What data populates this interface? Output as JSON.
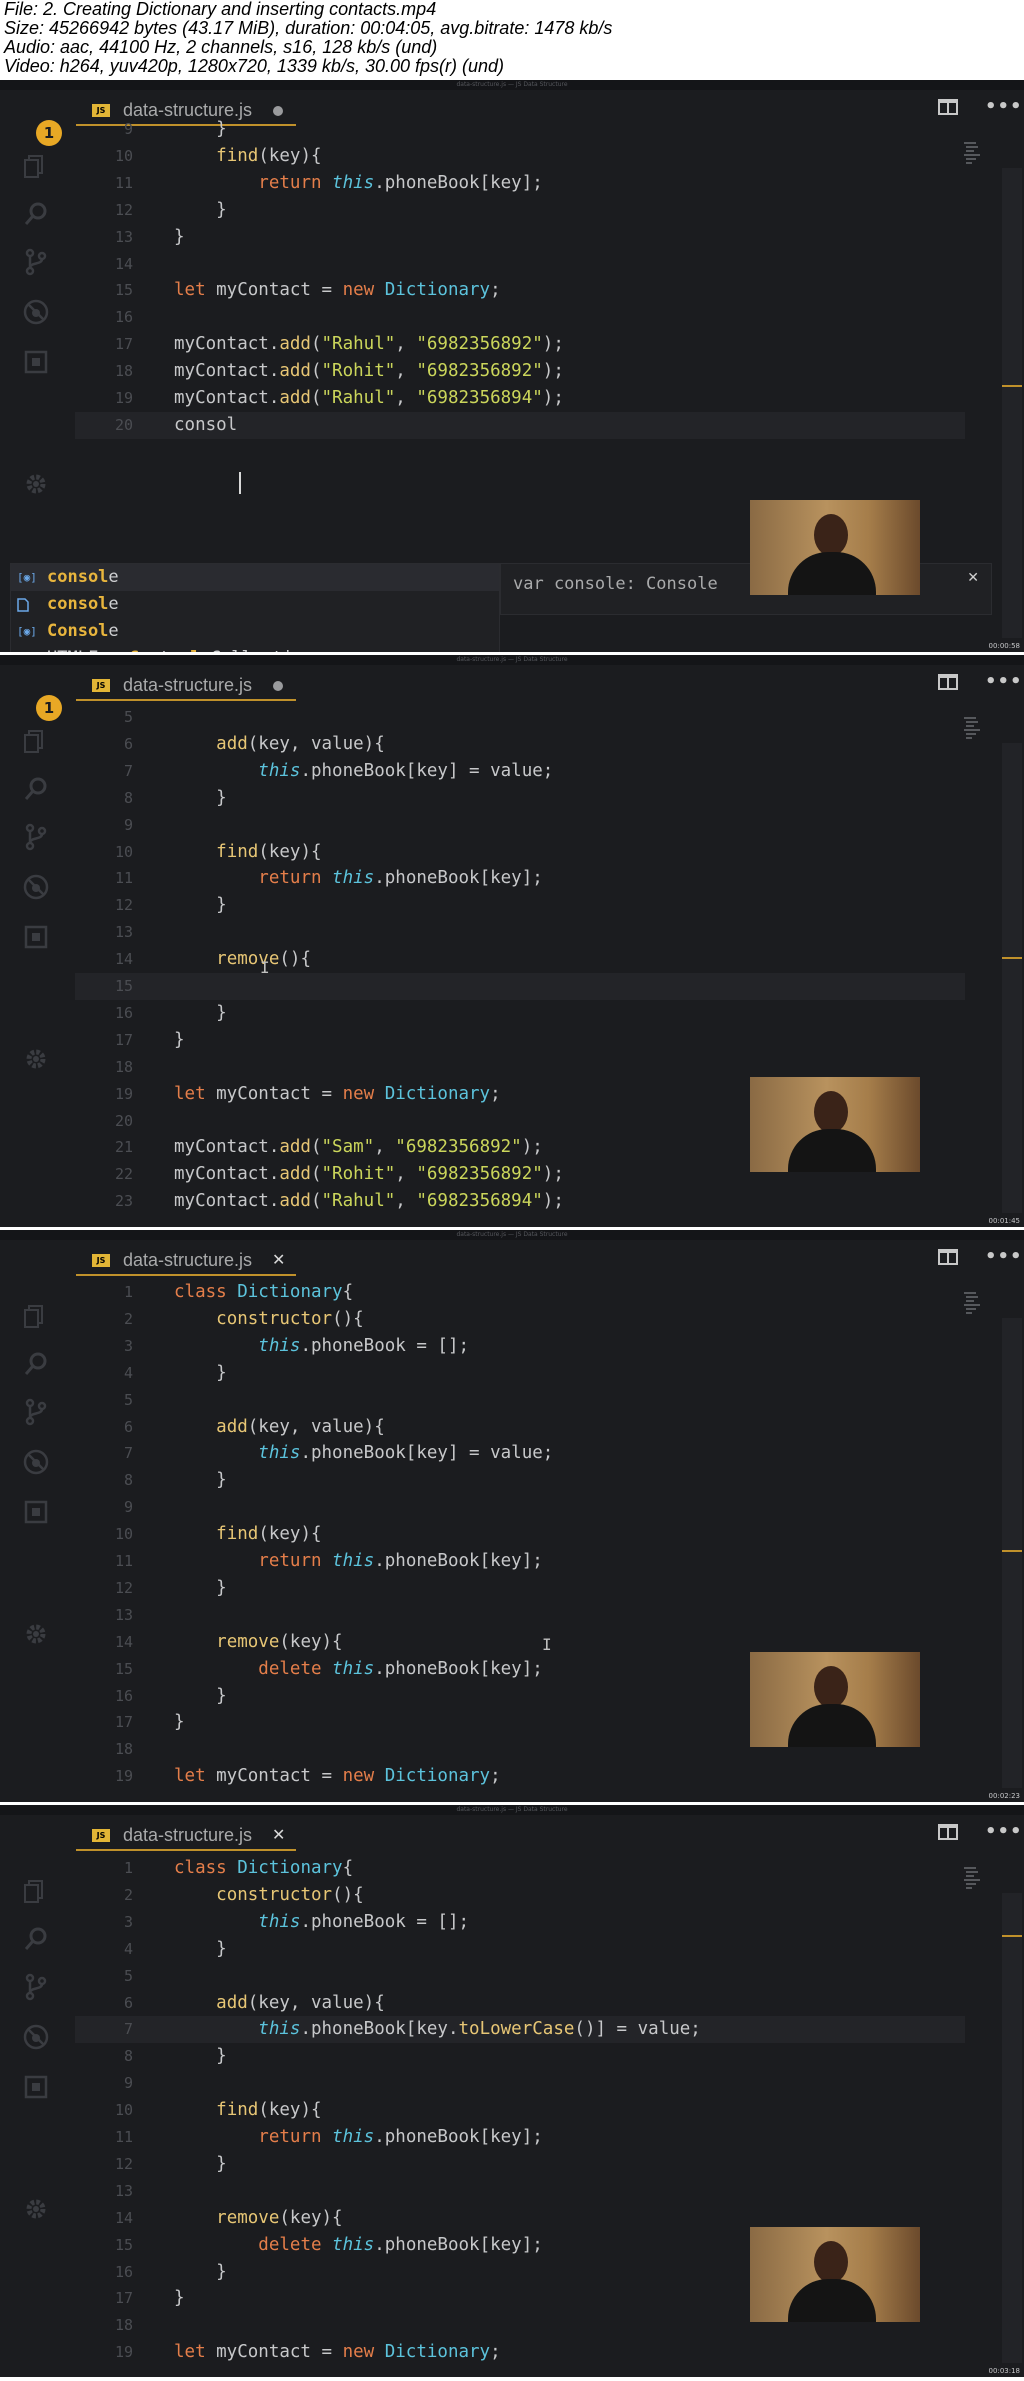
{
  "header": {
    "lines": [
      "File: 2. Creating Dictionary and inserting contacts.mp4",
      "Size: 45266942 bytes (43.17 MiB), duration: 00:04:05, avg.bitrate: 1478 kb/s",
      "Audio: aac, 44100 Hz, 2 channels, s16, 128 kb/s (und)",
      "Video: h264, yuv420p, 1280x720, 1339 kb/s, 30.00 fps(r) (und)"
    ]
  },
  "window_title": "data-structure.js — JS Data Structure",
  "tab_name": "data-structure.js",
  "badge_count": "1",
  "frames": [
    {
      "timestamp": "00:00:58",
      "lines": [
        {
          "n": "9",
          "code": "    }"
        },
        {
          "n": "10",
          "code": "    find(key){"
        },
        {
          "n": "11",
          "code": "        return this.phoneBook[key];"
        },
        {
          "n": "12",
          "code": "    }"
        },
        {
          "n": "13",
          "code": "}"
        },
        {
          "n": "14",
          "code": ""
        },
        {
          "n": "15",
          "code": "let myContact = new Dictionary;"
        },
        {
          "n": "16",
          "code": ""
        },
        {
          "n": "17",
          "code": "myContact.add(\"Rahul\", \"6982356892\");"
        },
        {
          "n": "18",
          "code": "myContact.add(\"Rohit\", \"6982356892\");"
        },
        {
          "n": "19",
          "code": "myContact.add(\"Rahul\", \"6982356894\");"
        },
        {
          "n": "20",
          "code": "consol"
        }
      ],
      "suggestions": [
        "console",
        "console",
        "Console",
        "HTMLFormControlsCollection"
      ],
      "detail": "var console: Console"
    },
    {
      "timestamp": "00:01:45",
      "lines": [
        {
          "n": "5",
          "code": ""
        },
        {
          "n": "6",
          "code": "    add(key, value){"
        },
        {
          "n": "7",
          "code": "        this.phoneBook[key] = value;"
        },
        {
          "n": "8",
          "code": "    }"
        },
        {
          "n": "9",
          "code": ""
        },
        {
          "n": "10",
          "code": "    find(key){"
        },
        {
          "n": "11",
          "code": "        return this.phoneBook[key];"
        },
        {
          "n": "12",
          "code": "    }"
        },
        {
          "n": "13",
          "code": ""
        },
        {
          "n": "14",
          "code": "    remove(){"
        },
        {
          "n": "15",
          "code": ""
        },
        {
          "n": "16",
          "code": "    }"
        },
        {
          "n": "17",
          "code": "}"
        },
        {
          "n": "18",
          "code": ""
        },
        {
          "n": "19",
          "code": "let myContact = new Dictionary;"
        },
        {
          "n": "20",
          "code": ""
        },
        {
          "n": "21",
          "code": "myContact.add(\"Sam\", \"6982356892\");"
        },
        {
          "n": "22",
          "code": "myContact.add(\"Rohit\", \"6982356892\");"
        },
        {
          "n": "23",
          "code": "myContact.add(\"Rahul\", \"6982356894\");"
        }
      ]
    },
    {
      "timestamp": "00:02:23",
      "lines": [
        {
          "n": "1",
          "code": "class Dictionary{"
        },
        {
          "n": "2",
          "code": "    constructor(){"
        },
        {
          "n": "3",
          "code": "        this.phoneBook = [];"
        },
        {
          "n": "4",
          "code": "    }"
        },
        {
          "n": "5",
          "code": ""
        },
        {
          "n": "6",
          "code": "    add(key, value){"
        },
        {
          "n": "7",
          "code": "        this.phoneBook[key] = value;"
        },
        {
          "n": "8",
          "code": "    }"
        },
        {
          "n": "9",
          "code": ""
        },
        {
          "n": "10",
          "code": "    find(key){"
        },
        {
          "n": "11",
          "code": "        return this.phoneBook[key];"
        },
        {
          "n": "12",
          "code": "    }"
        },
        {
          "n": "13",
          "code": ""
        },
        {
          "n": "14",
          "code": "    remove(key){"
        },
        {
          "n": "15",
          "code": "        delete this.phoneBook[key];"
        },
        {
          "n": "16",
          "code": "    }"
        },
        {
          "n": "17",
          "code": "}"
        },
        {
          "n": "18",
          "code": ""
        },
        {
          "n": "19",
          "code": "let myContact = new Dictionary;"
        }
      ]
    },
    {
      "timestamp": "00:03:18",
      "lines": [
        {
          "n": "1",
          "code": "class Dictionary{"
        },
        {
          "n": "2",
          "code": "    constructor(){"
        },
        {
          "n": "3",
          "code": "        this.phoneBook = [];"
        },
        {
          "n": "4",
          "code": "    }"
        },
        {
          "n": "5",
          "code": ""
        },
        {
          "n": "6",
          "code": "    add(key, value){"
        },
        {
          "n": "7",
          "code": "        this.phoneBook[key.toLowerCase()] = value;"
        },
        {
          "n": "8",
          "code": "    }"
        },
        {
          "n": "9",
          "code": ""
        },
        {
          "n": "10",
          "code": "    find(key){"
        },
        {
          "n": "11",
          "code": "        return this.phoneBook[key];"
        },
        {
          "n": "12",
          "code": "    }"
        },
        {
          "n": "13",
          "code": ""
        },
        {
          "n": "14",
          "code": "    remove(key){"
        },
        {
          "n": "15",
          "code": "        delete this.phoneBook[key];"
        },
        {
          "n": "16",
          "code": "    }"
        },
        {
          "n": "17",
          "code": "}"
        },
        {
          "n": "18",
          "code": ""
        },
        {
          "n": "19",
          "code": "let myContact = new Dictionary;"
        }
      ]
    }
  ],
  "colors": {
    "editor_bg": "#1b1c1f",
    "keyword": "#e47e4a",
    "function": "#e7c675",
    "string": "#cbd65b",
    "class": "#5cc3dc",
    "accent": "#c0912b"
  }
}
